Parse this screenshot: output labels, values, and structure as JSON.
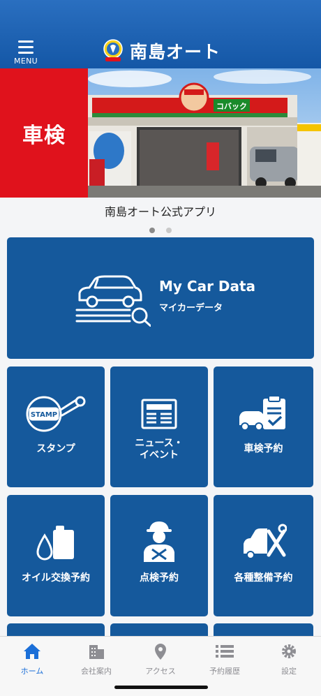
{
  "header": {
    "menu_label": "MENU",
    "brand_name": "南島オート"
  },
  "banner": {
    "label": "車検",
    "sign_text": "コバック",
    "caption": "南島オート公式アプリ",
    "page_count": 2,
    "active_page": 1
  },
  "tiles": {
    "my_car": {
      "title": "My Car Data",
      "subtitle": "マイカーデータ"
    },
    "stamp": {
      "label": "スタンプ",
      "badge": "STAMP"
    },
    "news_line1": "ニュース・",
    "news_line2": "イベント",
    "inspection": {
      "label": "車検予約"
    },
    "oil": {
      "label": "オイル交換予約"
    },
    "check": {
      "label": "点検予約"
    },
    "maintenance": {
      "label": "各種整備予約"
    }
  },
  "tabbar": {
    "items": [
      {
        "label": "ホーム",
        "icon": "home-icon",
        "active": true
      },
      {
        "label": "会社案内",
        "icon": "building-icon",
        "active": false
      },
      {
        "label": "アクセス",
        "icon": "map-pin-icon",
        "active": false
      },
      {
        "label": "予約履歴",
        "icon": "list-icon",
        "active": false
      },
      {
        "label": "設定",
        "icon": "gear-icon",
        "active": false
      }
    ]
  },
  "colors": {
    "header_blue": "#1a62b3",
    "tile_blue": "#15599c",
    "banner_red": "#e0121c",
    "tab_active": "#1b6fd8",
    "tab_inactive": "#8e8e93"
  }
}
